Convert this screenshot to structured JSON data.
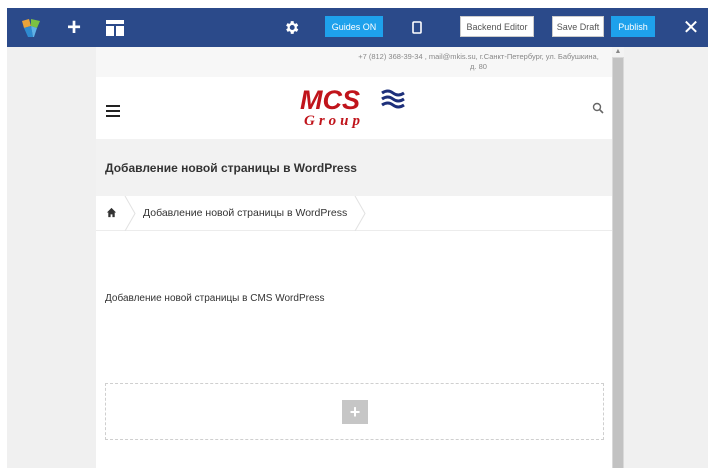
{
  "toolbar": {
    "guides_label": "Guides ON",
    "backend_label": "Backend Editor",
    "draft_label": "Save Draft",
    "publish_label": "Publish",
    "add_symbol": "+",
    "close_symbol": "✕",
    "bg_color": "#2b4a8a",
    "accent_color": "#1ea1ec"
  },
  "site": {
    "contact": "+7 (812) 368-39-34 , mail@mkis.su, г.Санкт-Петербург, ул. Бабушкина, д. 80",
    "logo_main": "MCS",
    "logo_sub": "Group",
    "brand_color": "#c0141b",
    "page_title": "Добавление новой страницы в WordPress",
    "breadcrumb": [
      "Добавление новой страницы в WordPress"
    ],
    "content_text": "Добавление новой страницы в CMS WordPress",
    "add_symbol": "+"
  },
  "icons": [
    "vc-logo-icon",
    "add-icon",
    "layout-icon",
    "gear-icon",
    "mobile-icon",
    "close-icon",
    "menu-icon",
    "search-icon",
    "home-icon"
  ]
}
